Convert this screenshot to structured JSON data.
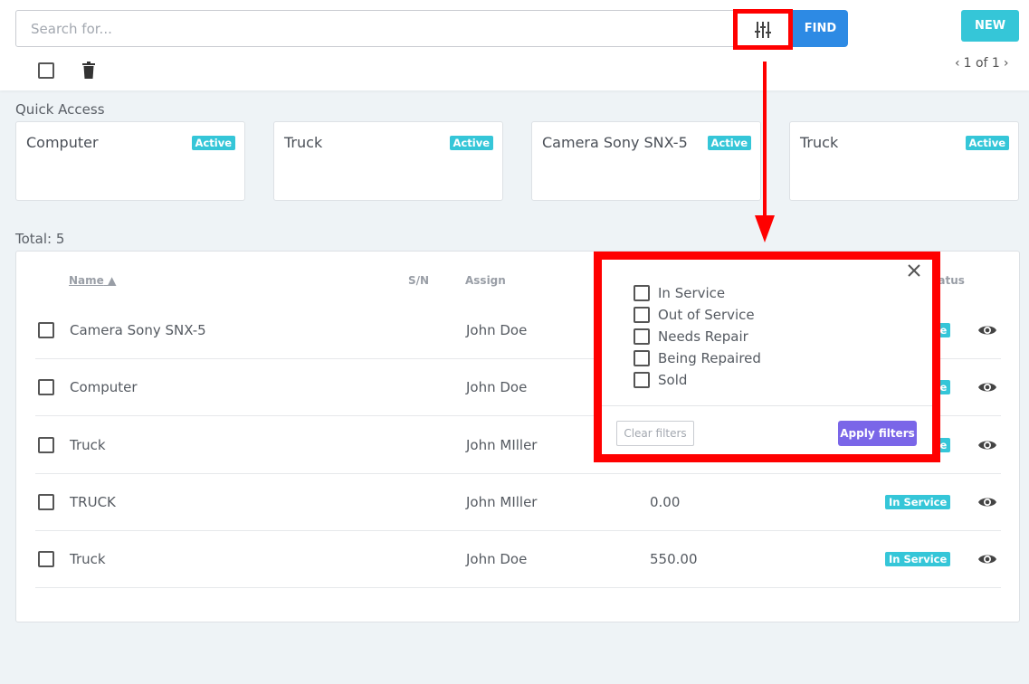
{
  "search": {
    "placeholder": "Search for...",
    "find_label": "FIND",
    "filter_icon": "sliders-icon"
  },
  "toolbar": {
    "new_label": "NEW",
    "pagination": "1 of 1"
  },
  "quick_access": {
    "title": "Quick Access",
    "cards": [
      {
        "name": "Computer",
        "status": "Active"
      },
      {
        "name": "Truck",
        "status": "Active"
      },
      {
        "name": "Camera Sony SNX-5",
        "status": "Active"
      },
      {
        "name": "Truck",
        "status": "Active"
      }
    ]
  },
  "total": "Total: 5",
  "table": {
    "columns": {
      "name": "Name",
      "sn": "S/N",
      "assign": "Assign",
      "status": "Status"
    },
    "rows": [
      {
        "name": "Camera Sony SNX-5",
        "sn": "",
        "assign": "John Doe",
        "value": "",
        "status": "In Service"
      },
      {
        "name": "Computer",
        "sn": "",
        "assign": "John Doe",
        "value": "",
        "status": "In Service"
      },
      {
        "name": "Truck",
        "sn": "",
        "assign": "John MIller",
        "value": "",
        "status": "In Service"
      },
      {
        "name": "TRUCK",
        "sn": "",
        "assign": "John MIller",
        "value": "0.00",
        "status": "In Service"
      },
      {
        "name": "Truck",
        "sn": "",
        "assign": "John Doe",
        "value": "550.00",
        "status": "In Service"
      }
    ]
  },
  "filter_popup": {
    "options": [
      "In Service",
      "Out of Service",
      "Needs Repair",
      "Being Repaired",
      "Sold"
    ],
    "clear_label": "Clear filters",
    "apply_label": "Apply filters"
  },
  "colors": {
    "accent": "#2d8ae4",
    "badge": "#35c6d8",
    "apply": "#7a66e8",
    "highlight": "#ff0000"
  }
}
